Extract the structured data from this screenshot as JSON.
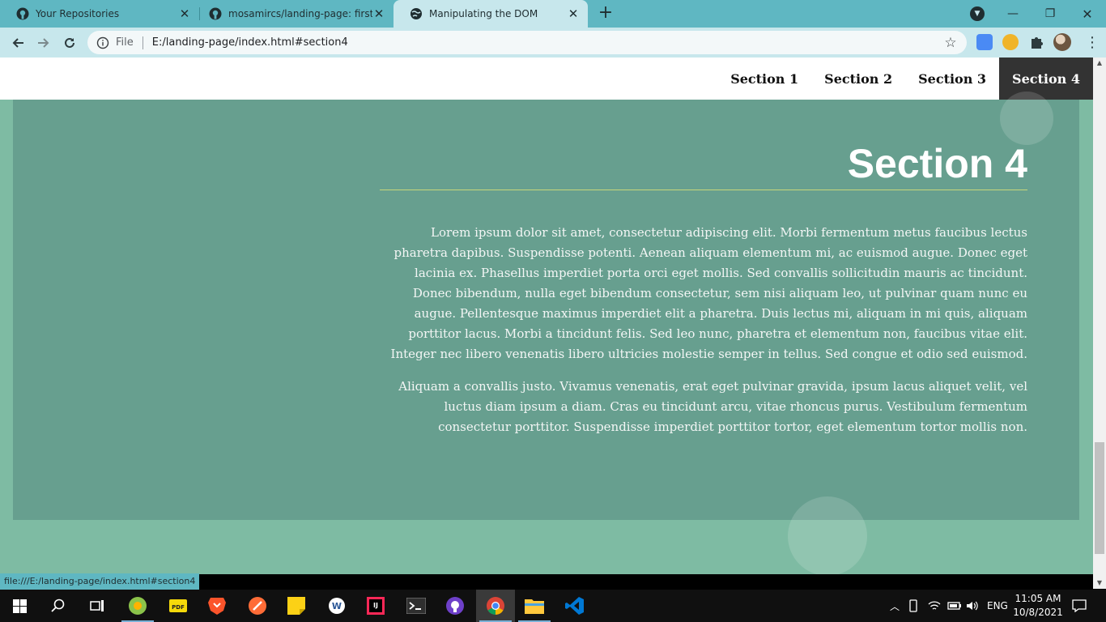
{
  "browser": {
    "tabs": [
      {
        "title": "Your Repositories",
        "active": false
      },
      {
        "title": "mosamircs/landing-page: first pr",
        "active": false
      },
      {
        "title": "Manipulating the DOM",
        "active": true
      }
    ],
    "new_tab_symbol": "+",
    "omnibox": {
      "protocol_label": "File",
      "url": "E:/landing-page/index.html#section4"
    },
    "status_url": "file:///E:/landing-page/index.html#section4",
    "colors": {
      "frame": "#5fb7c2",
      "toolbar": "#c7e7ec"
    }
  },
  "page": {
    "nav": [
      {
        "label": "Section 1",
        "active": false
      },
      {
        "label": "Section 2",
        "active": false
      },
      {
        "label": "Section 3",
        "active": false
      },
      {
        "label": "Section 4",
        "active": true
      }
    ],
    "section": {
      "heading": "Section 4",
      "paragraphs": [
        "Lorem ipsum dolor sit amet, consectetur adipiscing elit. Morbi fermentum metus faucibus lectus pharetra dapibus. Suspendisse potenti. Aenean aliquam elementum mi, ac euismod augue. Donec eget lacinia ex. Phasellus imperdiet porta orci eget mollis. Sed convallis sollicitudin mauris ac tincidunt. Donec bibendum, nulla eget bibendum consectetur, sem nisi aliquam leo, ut pulvinar quam nunc eu augue. Pellentesque maximus imperdiet elit a pharetra. Duis lectus mi, aliquam in mi quis, aliquam porttitor lacus. Morbi a tincidunt felis. Sed leo nunc, pharetra et elementum non, faucibus vitae elit. Integer nec libero venenatis libero ultricies molestie semper in tellus. Sed congue et odio sed euismod.",
        "Aliquam a convallis justo. Vivamus venenatis, erat eget pulvinar gravida, ipsum lacus aliquet velit, vel luctus diam ipsum a diam. Cras eu tincidunt arcu, vitae rhoncus purus. Vestibulum fermentum consectetur porttitor. Suspendisse imperdiet porttitor tortor, eget elementum tortor mollis non."
      ]
    },
    "colors": {
      "background": "#7ebba3",
      "section": "#679f8f",
      "nav_active": "#333333",
      "heading_rule": "#c8d67a"
    }
  },
  "taskbar": {
    "apps": [
      "start-icon",
      "search-icon",
      "task-view-icon",
      "chromium-icon",
      "pdf-icon",
      "brave-icon",
      "postman-icon",
      "sticky-notes-icon",
      "word-icon",
      "intellij-icon",
      "terminal-icon",
      "github-desktop-icon",
      "chrome-icon",
      "file-explorer-icon",
      "vscode-icon"
    ],
    "language": "ENG",
    "time": "11:05 AM",
    "date": "10/8/2021"
  }
}
